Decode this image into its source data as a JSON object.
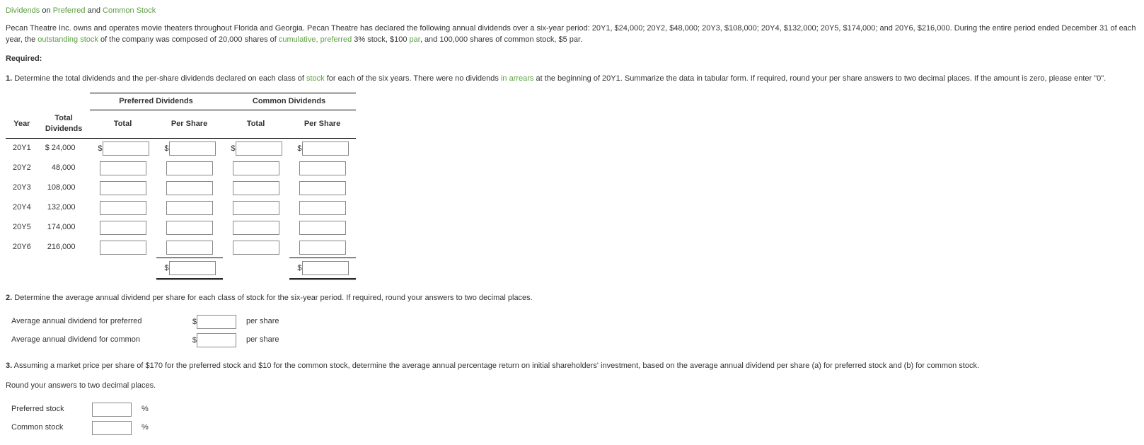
{
  "title": {
    "w1": "Dividends",
    "w2": "on",
    "w3": "Preferred",
    "w4": "and",
    "w5": "Common Stock"
  },
  "intro": {
    "p1a": "Pecan Theatre Inc. owns and operates movie theaters throughout Florida and Georgia. Pecan Theatre has declared the following annual dividends over a six-year period: 20Y1, $24,000; 20Y2, $48,000; 20Y3, $108,000; 20Y4, $132,000; 20Y5, $174,000; and 20Y6, $216,000. During the entire period ended December 31 of each year, the ",
    "p1b": "outstanding stock",
    "p1c": " of the company was composed of 20,000 shares of ",
    "p1d": "cumulative, preferred",
    "p1e": " 3% stock, $100 ",
    "p1f": "par",
    "p1g": ", and 100,000 shares of common stock, $5 par."
  },
  "required": "Required:",
  "q1": {
    "num": "1.",
    "a": "  Determine the total dividends and the per-share dividends declared on each class of ",
    "b": "stock",
    "c": " for each of the six years. There were no dividends ",
    "d": "in arrears",
    "e": " at the beginning of 20Y1. Summarize the data in tabular form. If required, round your per share answers to two decimal places. If the amount is zero, please enter \"0\"."
  },
  "table": {
    "pref_hdr": "Preferred Dividends",
    "com_hdr": "Common Dividends",
    "year_hdr": "Year",
    "totdiv_hdr1": "Total",
    "totdiv_hdr2": "Dividends",
    "total_hdr": "Total",
    "pershare_hdr": "Per Share",
    "rows": [
      {
        "year": "20Y1",
        "div": "$   24,000"
      },
      {
        "year": "20Y2",
        "div": "48,000"
      },
      {
        "year": "20Y3",
        "div": "108,000"
      },
      {
        "year": "20Y4",
        "div": "132,000"
      },
      {
        "year": "20Y5",
        "div": "174,000"
      },
      {
        "year": "20Y6",
        "div": "216,000"
      }
    ]
  },
  "q2": {
    "num": "2.",
    "text": "  Determine the average annual dividend per share for each class of stock for the six-year period. If required, round your answers to two decimal places.",
    "row1": "Average annual dividend for preferred",
    "row2": "Average annual dividend for common",
    "unit": "per share"
  },
  "q3": {
    "num": "3.",
    "text": "  Assuming a market price per share of $170 for the preferred stock and $10 for the common stock, determine the average annual percentage return on initial shareholders' investment, based on the average annual dividend per share (a) for preferred stock and (b) for common stock.",
    "round": "Round your answers to two decimal places.",
    "row1": "Preferred stock",
    "row2": "Common stock",
    "pct": "%"
  }
}
